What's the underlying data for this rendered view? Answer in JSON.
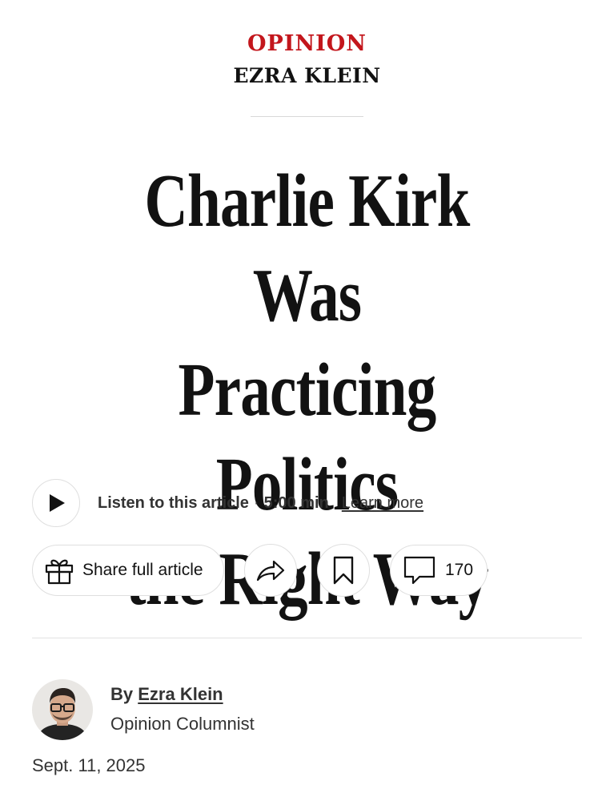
{
  "kicker": {
    "section": "OPINION",
    "column": "EZRA KLEIN",
    "section_color": "#c3161c"
  },
  "headline": {
    "line1": "Charlie Kirk Was",
    "line2": "Practicing Politics",
    "line3": "the Right Way"
  },
  "listen": {
    "play_icon": "play-icon",
    "label": "Listen to this article",
    "separator": "·",
    "duration": "5:00 min",
    "learn_more": "Learn more"
  },
  "actions": {
    "share_full_label": "Share full article",
    "share_full_icon": "gift-icon",
    "share_icon": "share-arrow-icon",
    "save_icon": "bookmark-icon",
    "comments_icon": "comment-bubble-icon",
    "comments_count": "170"
  },
  "byline": {
    "prefix": "By",
    "author": "Ezra Klein",
    "role": "Opinion Columnist",
    "avatar_icon": "author-avatar"
  },
  "date": "Sept. 11, 2025"
}
